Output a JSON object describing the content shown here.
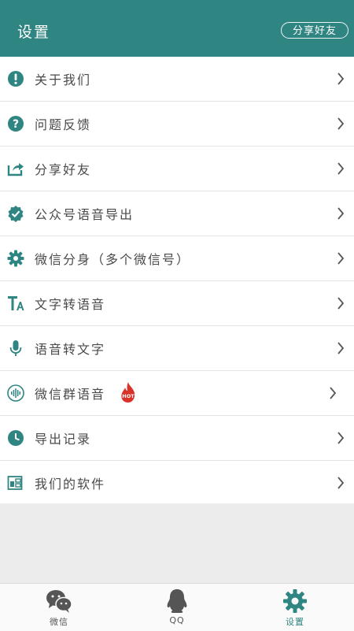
{
  "header": {
    "title": "设置",
    "share_button": "分享好友"
  },
  "menu": {
    "items": [
      {
        "label": "关于我们",
        "icon": "info-icon"
      },
      {
        "label": "问题反馈",
        "icon": "question-icon"
      },
      {
        "label": "分享好友",
        "icon": "share-icon"
      },
      {
        "label": "公众号语音导出",
        "icon": "verified-badge-icon"
      },
      {
        "label": "微信分身（多个微信号）",
        "icon": "gear-icon"
      },
      {
        "label": "文字转语音",
        "icon": "text-to-speech-icon"
      },
      {
        "label": "语音转文字",
        "icon": "microphone-icon"
      },
      {
        "label": "微信群语音",
        "icon": "voice-wave-icon",
        "badge": "HOT"
      },
      {
        "label": "导出记录",
        "icon": "clock-icon"
      },
      {
        "label": "我们的软件",
        "icon": "apps-icon"
      }
    ]
  },
  "tabs": [
    {
      "label": "微信",
      "icon": "wechat-icon",
      "active": false
    },
    {
      "label": "QQ",
      "icon": "qq-penguin-icon",
      "active": false
    },
    {
      "label": "设置",
      "icon": "settings-gear-icon",
      "active": true
    }
  ],
  "colors": {
    "brand": "#2f8582",
    "badge": "#d8322b"
  }
}
